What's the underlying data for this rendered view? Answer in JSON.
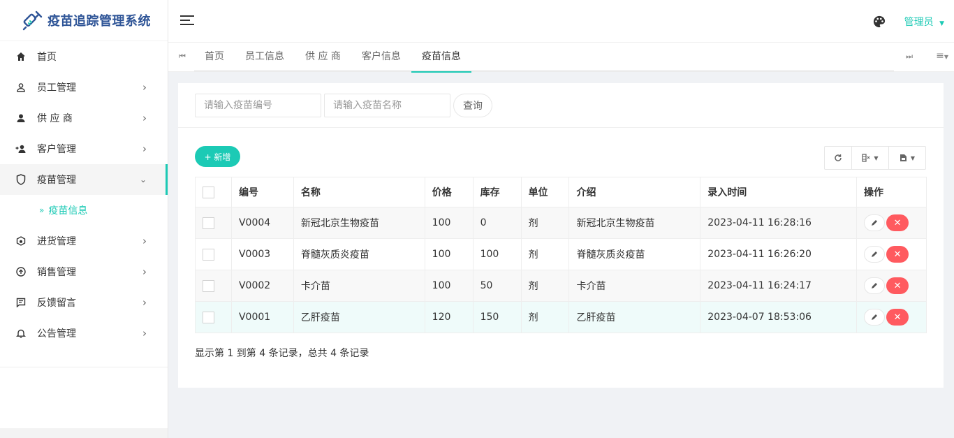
{
  "app": {
    "title": "疫苗追踪管理系统"
  },
  "sidebar": {
    "items": [
      {
        "label": "首页",
        "icon": "home-icon",
        "has_arrow": false
      },
      {
        "label": "员工管理",
        "icon": "user-outline-icon",
        "has_arrow": true
      },
      {
        "label": "供 应 商",
        "icon": "user-icon",
        "has_arrow": true
      },
      {
        "label": "客户管理",
        "icon": "user-add-icon",
        "has_arrow": true
      },
      {
        "label": "疫苗管理",
        "icon": "shield-icon",
        "has_arrow": true,
        "expanded": true
      },
      {
        "label": "进货管理",
        "icon": "box-icon",
        "has_arrow": true
      },
      {
        "label": "销售管理",
        "icon": "upload-circle-icon",
        "has_arrow": true
      },
      {
        "label": "反馈留言",
        "icon": "message-icon",
        "has_arrow": true
      },
      {
        "label": "公告管理",
        "icon": "bell-icon",
        "has_arrow": true
      }
    ],
    "subitem": {
      "label": "疫苗信息"
    }
  },
  "header": {
    "user": "管理员"
  },
  "tabs": [
    "首页",
    "员工信息",
    "供 应 商",
    "客户信息",
    "疫苗信息"
  ],
  "active_tab": "疫苗信息",
  "search": {
    "code_placeholder": "请输入疫苗编号",
    "name_placeholder": "请输入疫苗名称",
    "query_label": "查询"
  },
  "toolbar": {
    "add_label": "+ 新增"
  },
  "table": {
    "headers": [
      "编号",
      "名称",
      "价格",
      "库存",
      "单位",
      "介绍",
      "录入时间",
      "操作"
    ],
    "rows": [
      [
        "V0004",
        "新冠北京生物疫苗",
        "100",
        "0",
        "剂",
        "新冠北京生物疫苗",
        "2023-04-11 16:28:16"
      ],
      [
        "V0003",
        "脊髓灰质炎疫苗",
        "100",
        "100",
        "剂",
        "脊髓灰质炎疫苗",
        "2023-04-11 16:26:20"
      ],
      [
        "V0002",
        "卡介苗",
        "100",
        "50",
        "剂",
        "卡介苗",
        "2023-04-11 16:24:17"
      ],
      [
        "V0001",
        "乙肝疫苗",
        "120",
        "150",
        "剂",
        "乙肝疫苗",
        "2023-04-07 18:53:06"
      ]
    ]
  },
  "pager": {
    "info": "显示第 1 到第 4 条记录，总共 4 条记录"
  },
  "colors": {
    "accent": "#1ccab5",
    "danger": "#ff5a5f",
    "brand": "#2f5597"
  }
}
